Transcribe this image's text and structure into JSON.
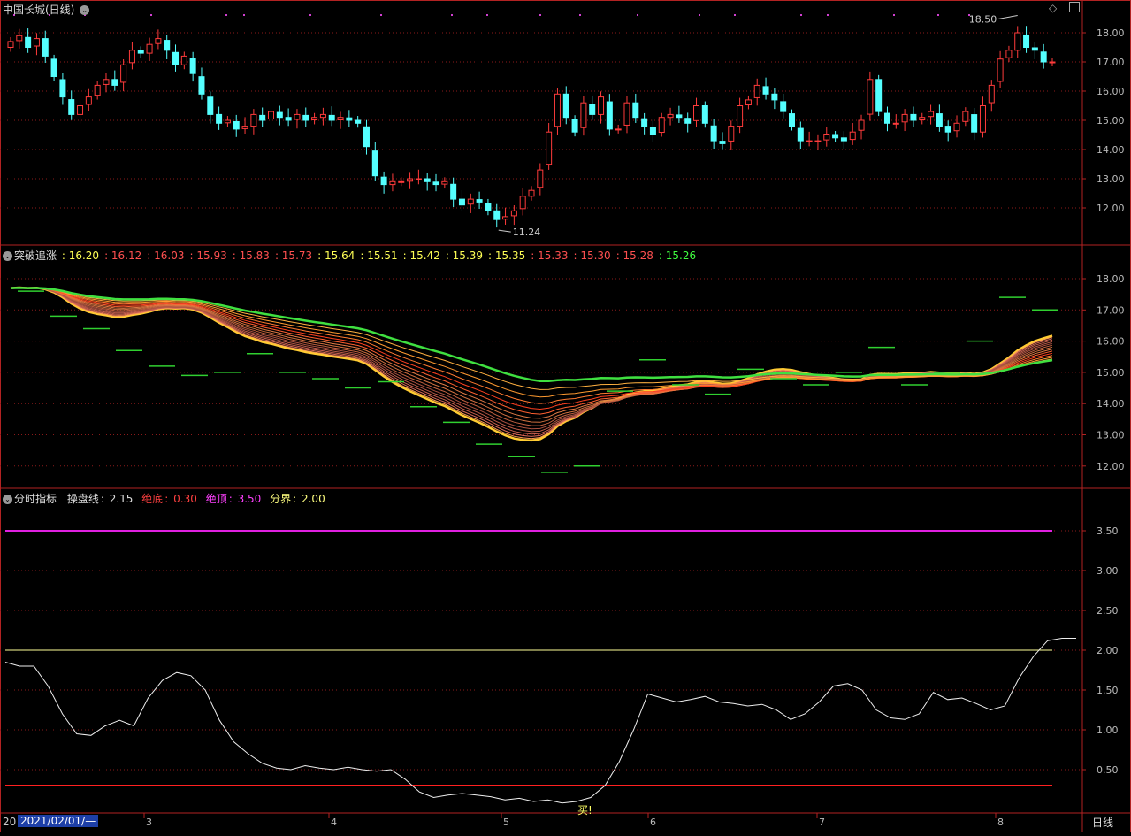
{
  "window": {
    "title": "中国长城(日线)",
    "period_label": "日线",
    "date_box": "2021/02/01/—",
    "date_prefix": "20"
  },
  "panel1": {
    "y_ticks": [
      "18.00",
      "17.00",
      "16.00",
      "15.00",
      "14.00",
      "13.00",
      "12.00"
    ],
    "high_label": "18.50",
    "low_label": "11.24"
  },
  "panel2": {
    "title": "突破追涨",
    "values": [
      "16.20",
      "16.12",
      "16.03",
      "15.93",
      "15.83",
      "15.73",
      "15.64",
      "15.51",
      "15.42",
      "15.39",
      "15.35",
      "15.33",
      "15.30",
      "15.28",
      "15.26"
    ],
    "value_colors": [
      "#ffff55",
      "#ff5050",
      "#ff5050",
      "#ff5050",
      "#ff5050",
      "#ff5050",
      "#ffff55",
      "#ffff55",
      "#ffff55",
      "#ffff55",
      "#ffff55",
      "#ff5050",
      "#ff5050",
      "#ff5050",
      "#40ff40"
    ],
    "y_ticks": [
      "18.00",
      "17.00",
      "16.00",
      "15.00",
      "14.00",
      "13.00",
      "12.00"
    ]
  },
  "panel3": {
    "title": "分时指标",
    "line_name": "操盘线",
    "line_value": "2.15",
    "bottom_name": "绝底",
    "bottom_value": "0.30",
    "top_name": "绝顶",
    "top_value": "3.50",
    "divide_name": "分界",
    "divide_value": "2.00",
    "y_ticks": [
      "3.50",
      "3.00",
      "2.50",
      "2.00",
      "1.50",
      "1.00",
      "0.50"
    ],
    "buy_label": "买!"
  },
  "x_axis": {
    "ticks": [
      "3",
      "4",
      "5",
      "6",
      "7",
      "8"
    ]
  },
  "colors": {
    "up": "#ff3b3b",
    "down": "#54ffff",
    "grid": "#8b1a1a",
    "frame": "#b22222"
  },
  "chart_data": {
    "type": "candlestick",
    "ylim": [
      11,
      19
    ],
    "close": [
      17.7,
      17.9,
      17.5,
      17.8,
      17.2,
      16.5,
      15.8,
      15.2,
      15.5,
      15.8,
      16.2,
      16.4,
      16.2,
      16.9,
      17.4,
      17.3,
      17.6,
      17.8,
      17.4,
      16.9,
      17.2,
      16.6,
      15.9,
      15.2,
      14.9,
      15.0,
      14.7,
      14.8,
      15.2,
      15.0,
      15.3,
      15.1,
      15.0,
      15.2,
      15.0,
      15.1,
      15.2,
      15.0,
      15.1,
      15.0,
      14.9,
      14.1,
      13.1,
      12.8,
      12.9,
      12.9,
      13.0,
      13.0,
      12.9,
      12.8,
      12.9,
      12.3,
      12.1,
      12.3,
      12.2,
      11.9,
      11.6,
      11.7,
      11.9,
      12.4,
      12.6,
      13.3,
      14.6,
      15.9,
      15.1,
      14.6,
      15.6,
      15.2,
      15.8,
      14.7,
      14.7,
      15.6,
      15.1,
      14.8,
      14.5,
      15.1,
      15.2,
      15.1,
      14.9,
      15.5,
      14.9,
      14.3,
      14.2,
      14.8,
      15.5,
      15.7,
      16.2,
      15.9,
      15.7,
      15.3,
      14.8,
      14.3,
      14.3,
      14.3,
      14.5,
      14.4,
      14.3,
      14.6,
      15.0,
      16.4,
      15.3,
      14.9,
      14.9,
      15.2,
      15.0,
      15.1,
      15.3,
      14.8,
      14.6,
      14.9,
      15.3,
      14.6,
      15.5,
      16.2,
      17.1,
      17.4,
      18.0,
      17.5,
      17.4,
      17.0,
      17.0
    ],
    "indicator_line": [
      1.85,
      1.8,
      1.8,
      1.55,
      1.2,
      0.95,
      0.93,
      1.05,
      1.12,
      1.05,
      1.4,
      1.62,
      1.72,
      1.68,
      1.5,
      1.12,
      0.85,
      0.7,
      0.58,
      0.52,
      0.5,
      0.55,
      0.52,
      0.5,
      0.53,
      0.5,
      0.48,
      0.5,
      0.38,
      0.22,
      0.15,
      0.18,
      0.2,
      0.18,
      0.16,
      0.12,
      0.14,
      0.1,
      0.12,
      0.08,
      0.1,
      0.15,
      0.3,
      0.6,
      1.0,
      1.45,
      1.4,
      1.35,
      1.38,
      1.42,
      1.35,
      1.33,
      1.3,
      1.32,
      1.25,
      1.13,
      1.2,
      1.35,
      1.55,
      1.58,
      1.5,
      1.25,
      1.15,
      1.13,
      1.2,
      1.47,
      1.38,
      1.4,
      1.33,
      1.25,
      1.3,
      1.65,
      1.92,
      2.12,
      2.15,
      2.15
    ],
    "ma_bands_last": [
      16.2,
      16.12,
      16.03,
      15.93,
      15.83,
      15.73,
      15.64,
      15.51,
      15.42,
      15.39,
      15.35,
      15.33,
      15.3,
      15.28,
      15.26
    ]
  }
}
